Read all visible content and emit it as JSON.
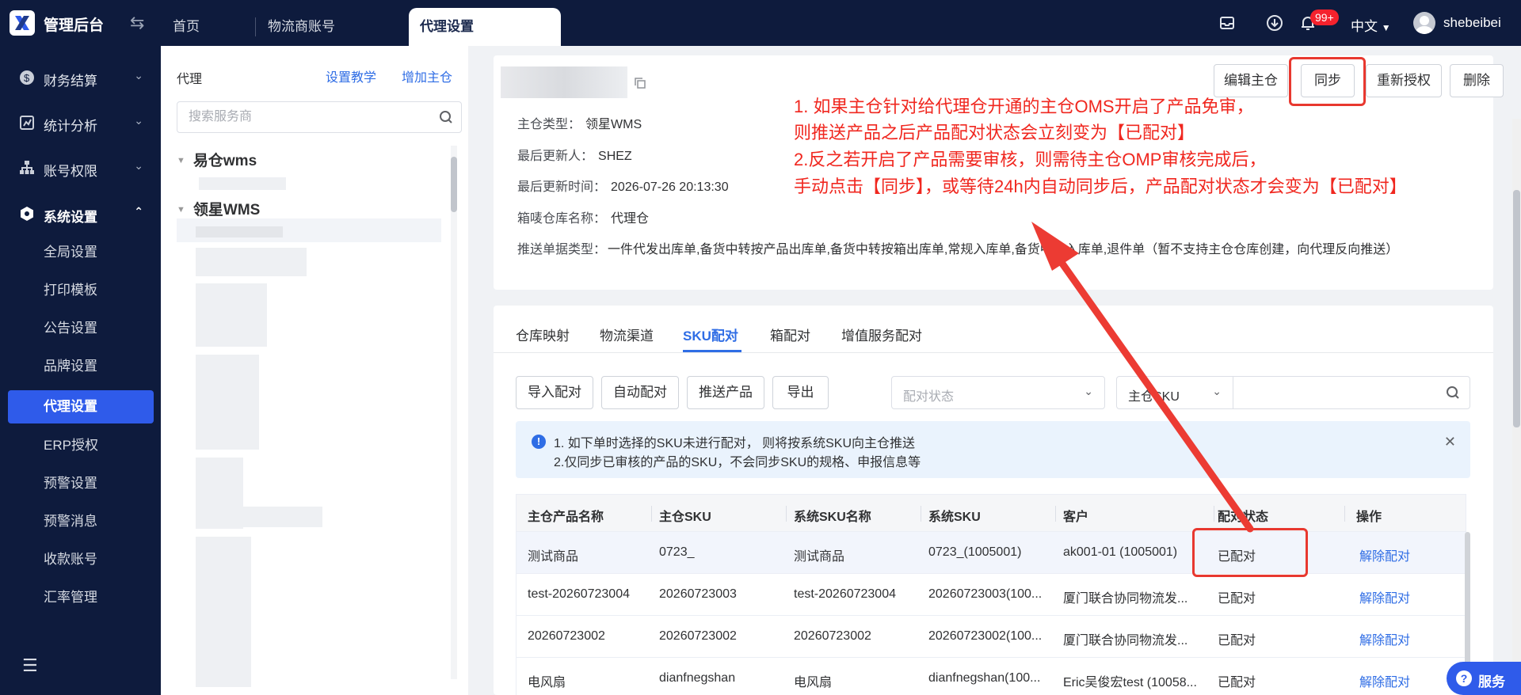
{
  "topbar": {
    "brand": "管理后台",
    "tabs": [
      {
        "label": "首页"
      },
      {
        "label": "物流商账号"
      },
      {
        "label": "代理设置"
      }
    ],
    "notification_badge": "99+",
    "language": "中文",
    "username": "shebeibei"
  },
  "sidebar": {
    "groups": [
      {
        "label": "财务结算",
        "icon": "dollar-icon"
      },
      {
        "label": "统计分析",
        "icon": "chart-icon"
      },
      {
        "label": "账号权限",
        "icon": "org-icon"
      },
      {
        "label": "系统设置",
        "icon": "gear-icon"
      }
    ],
    "items": [
      {
        "label": "全局设置"
      },
      {
        "label": "打印模板"
      },
      {
        "label": "公告设置"
      },
      {
        "label": "品牌设置"
      },
      {
        "label": "代理设置"
      },
      {
        "label": "ERP授权"
      },
      {
        "label": "预警设置"
      },
      {
        "label": "预警消息"
      },
      {
        "label": "收款账号"
      },
      {
        "label": "汇率管理"
      }
    ]
  },
  "agent_panel": {
    "title": "代理",
    "link_tutorial": "设置教学",
    "link_add": "增加主仓",
    "search_placeholder": "搜索服务商",
    "tree": [
      {
        "label": "易仓wms"
      },
      {
        "label": "领星WMS"
      }
    ]
  },
  "detail": {
    "rows": [
      {
        "label": "主仓类型：",
        "value": "领星WMS"
      },
      {
        "label": "最后更新人：",
        "value": "SHEZ"
      },
      {
        "label": "最后更新时间：",
        "value": "2026-07-26 20:13:30"
      },
      {
        "label": "箱唛仓库名称：",
        "value": "代理仓"
      },
      {
        "label": "推送单据类型：",
        "value": "一件代发出库单,备货中转按产品出库单,备货中转按箱出库单,常规入库单,备货中转入库单,退件单（暂不支持主仓仓库创建，向代理反向推送）"
      }
    ],
    "buttons": {
      "edit": "编辑主仓",
      "sync": "同步",
      "reauth": "重新授权",
      "delete": "删除"
    }
  },
  "annotation": {
    "lines": [
      "1. 如果主仓针对给代理仓开通的主仓OMS开启了产品免审，",
      "则推送产品之后产品配对状态会立刻变为【已配对】",
      "2.反之若开启了产品需要审核，则需待主仓OMP审核完成后，",
      "手动点击【同步】，或等待24h内自动同步后，产品配对状态才会变为【已配对】"
    ],
    "color": "#f0271f"
  },
  "sku_section": {
    "tabs": [
      {
        "label": "仓库映射"
      },
      {
        "label": "物流渠道"
      },
      {
        "label": "SKU配对"
      },
      {
        "label": "箱配对"
      },
      {
        "label": "增值服务配对"
      }
    ],
    "toolbar": {
      "import": "导入配对",
      "auto": "自动配对",
      "push": "推送产品",
      "export": "导出",
      "status_placeholder": "配对状态",
      "sku_type": "主仓SKU"
    },
    "alert": {
      "line1": "1. 如下单时选择的SKU未进行配对， 则将按系统SKU向主仓推送",
      "line2": "2.仅同步已审核的产品的SKU，不会同步SKU的规格、申报信息等"
    },
    "columns": [
      "主仓产品名称",
      "主仓SKU",
      "系统SKU名称",
      "系统SKU",
      "客户",
      "配对状态",
      "操作"
    ],
    "rows": [
      [
        "测试商品",
        "0723_",
        "测试商品",
        "0723_(1005001)",
        "ak001-01 (1005001)",
        "已配对",
        "解除配对"
      ],
      [
        "test-20260723004",
        "20260723003",
        "test-20260723004",
        "20260723003(100...",
        "厦门联合协同物流发...",
        "已配对",
        "解除配对"
      ],
      [
        "20260723002",
        "20260723002",
        "20260723002",
        "20260723002(100...",
        "厦门联合协同物流发...",
        "已配对",
        "解除配对"
      ],
      [
        "电风扇",
        "dianfnegshan",
        "电风扇",
        "dianfnegshan(100...",
        "Eric吴俊宏test (10058...",
        "已配对",
        "解除配对"
      ]
    ]
  },
  "service_button": "服务"
}
